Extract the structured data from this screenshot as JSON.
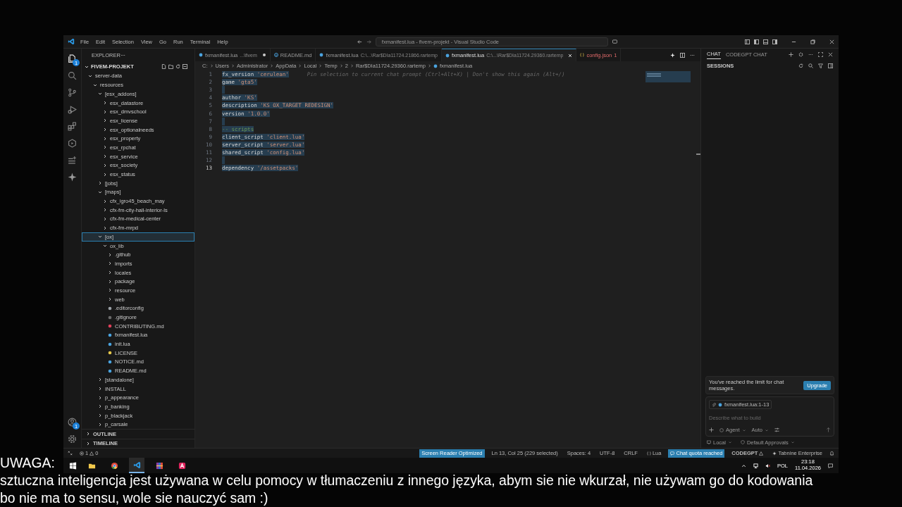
{
  "window": {
    "title": "fxmanifest.lua - fivem-projekt - Visual Studio Code",
    "menu": [
      "File",
      "Edit",
      "Selection",
      "View",
      "Go",
      "Run",
      "Terminal",
      "Help"
    ]
  },
  "activity_bar": {
    "explorer_badge": "1",
    "account_badge": "1"
  },
  "explorer": {
    "title": "EXPLORER",
    "project": "FIVEM-PROJEKT",
    "tree": [
      {
        "label": "server-data",
        "kind": "folder",
        "expanded": true,
        "selected": false,
        "children": [
          {
            "label": "resources",
            "kind": "folder",
            "expanded": true,
            "selected": false,
            "children": [
              {
                "label": "[esx_addons]",
                "kind": "folder",
                "expanded": true,
                "selected": false,
                "children": [
                  {
                    "label": "esx_datastore",
                    "kind": "folder",
                    "expanded": false,
                    "selected": false
                  },
                  {
                    "label": "esx_dmvschool",
                    "kind": "folder",
                    "expanded": false,
                    "selected": false
                  },
                  {
                    "label": "esx_license",
                    "kind": "folder",
                    "expanded": false,
                    "selected": false
                  },
                  {
                    "label": "esx_optionalneeds",
                    "kind": "folder",
                    "expanded": false,
                    "selected": false
                  },
                  {
                    "label": "esx_property",
                    "kind": "folder",
                    "expanded": false,
                    "selected": false
                  },
                  {
                    "label": "esx_rpchat",
                    "kind": "folder",
                    "expanded": false,
                    "selected": false
                  },
                  {
                    "label": "esx_service",
                    "kind": "folder",
                    "expanded": false,
                    "selected": false
                  },
                  {
                    "label": "esx_society",
                    "kind": "folder",
                    "expanded": false,
                    "selected": false
                  },
                  {
                    "label": "esx_status",
                    "kind": "folder",
                    "expanded": false,
                    "selected": false
                  }
                ]
              },
              {
                "label": "[jobs]",
                "kind": "folder",
                "expanded": false,
                "selected": false
              },
              {
                "label": "[maps]",
                "kind": "folder",
                "expanded": true,
                "selected": false,
                "children": [
                  {
                    "label": "cfx_igro45_beach_may",
                    "kind": "folder",
                    "expanded": false,
                    "selected": false
                  },
                  {
                    "label": "cfx-fm-city-hall-interior-ls",
                    "kind": "folder",
                    "expanded": false,
                    "selected": false
                  },
                  {
                    "label": "cfx-fm-medical-center",
                    "kind": "folder",
                    "expanded": false,
                    "selected": false
                  },
                  {
                    "label": "cfx-fm-mrpd",
                    "kind": "folder",
                    "expanded": false,
                    "selected": false
                  }
                ]
              },
              {
                "label": "[ox]",
                "kind": "folder",
                "expanded": true,
                "selected": true,
                "children": [
                  {
                    "label": "ox_lib",
                    "kind": "folder",
                    "expanded": true,
                    "selected": false,
                    "children": [
                      {
                        "label": ".github",
                        "kind": "folder",
                        "expanded": false,
                        "selected": false
                      },
                      {
                        "label": "imports",
                        "kind": "folder",
                        "expanded": false,
                        "selected": false
                      },
                      {
                        "label": "locales",
                        "kind": "folder",
                        "expanded": false,
                        "selected": false
                      },
                      {
                        "label": "package",
                        "kind": "folder",
                        "expanded": false,
                        "selected": false
                      },
                      {
                        "label": "resource",
                        "kind": "folder",
                        "expanded": false,
                        "selected": false
                      },
                      {
                        "label": "web",
                        "kind": "folder",
                        "expanded": false,
                        "selected": false
                      },
                      {
                        "label": ".editorconfig",
                        "kind": "gear",
                        "selected": false
                      },
                      {
                        "label": ".gitignore",
                        "kind": "ignore",
                        "selected": false
                      },
                      {
                        "label": "CONTRIBUTING.md",
                        "kind": "contributing",
                        "selected": false
                      },
                      {
                        "label": "fxmanifest.lua",
                        "kind": "lua",
                        "selected": false
                      },
                      {
                        "label": "init.lua",
                        "kind": "lua",
                        "selected": false
                      },
                      {
                        "label": "LICENSE",
                        "kind": "license",
                        "selected": false
                      },
                      {
                        "label": "NOTICE.md",
                        "kind": "notice",
                        "selected": false
                      },
                      {
                        "label": "README.md",
                        "kind": "info",
                        "selected": false
                      }
                    ]
                  }
                ]
              },
              {
                "label": "[standalone]",
                "kind": "folder",
                "expanded": false,
                "selected": false
              },
              {
                "label": "INSTALL",
                "kind": "folder",
                "expanded": false,
                "selected": false
              },
              {
                "label": "p_appearance",
                "kind": "folder",
                "expanded": false,
                "selected": false
              },
              {
                "label": "p_banking",
                "kind": "folder",
                "expanded": false,
                "selected": false
              },
              {
                "label": "p_blackjack",
                "kind": "folder",
                "expanded": false,
                "selected": false
              },
              {
                "label": "p_carsale",
                "kind": "folder",
                "expanded": false,
                "selected": false
              }
            ]
          }
        ]
      }
    ],
    "sections": [
      {
        "label": "OUTLINE",
        "expanded": false
      },
      {
        "label": "TIMELINE",
        "expanded": false
      }
    ]
  },
  "tabs": [
    {
      "label": "fxmanifest.lua",
      "description": "...\\fivem",
      "kind": "lua",
      "modified": true,
      "selected": false
    },
    {
      "label": "README.md",
      "kind": "info",
      "modified": false,
      "selected": false
    },
    {
      "label": "fxmanifest.lua",
      "description": "C:\\...\\Rar$DIa11724.21866.rartemp",
      "kind": "lua",
      "modified": false,
      "selected": false
    },
    {
      "label": "fxmanifest.lua",
      "description": "C:\\...\\Rar$DIa11724.29360.rartemp",
      "kind": "lua",
      "modified": false,
      "selected": true
    },
    {
      "label": "config.json",
      "badge": "1",
      "kind": "json",
      "modified": false,
      "selected": false
    }
  ],
  "breadcrumbs": [
    "C:",
    "Users",
    "Administrator",
    "AppData",
    "Local",
    "Temp",
    "2",
    "Rar$DIa11724.29360.rartemp",
    "fxmanifest.lua"
  ],
  "code": [
    {
      "number": "1",
      "text": "fx_version 'cerulean'",
      "selected": true,
      "hint": "Pin selection to current chat prompt (Ctrl+Alt+X) | Don't show this again (Alt+/)"
    },
    {
      "number": "2",
      "text": "game 'gta5'",
      "selected": true
    },
    {
      "number": "3",
      "selected": true
    },
    {
      "number": "4",
      "text": "author 'KS'",
      "selected": true
    },
    {
      "number": "5",
      "text": "description 'KS OX_TARGET REDESIGN'",
      "selected": true
    },
    {
      "number": "6",
      "text": "version '1.0.0'",
      "selected": true
    },
    {
      "number": "7",
      "selected": true
    },
    {
      "number": "8",
      "text": "-- scripts",
      "kind": "comment",
      "selected": true
    },
    {
      "number": "9",
      "text": "client_script 'client.lua'",
      "selected": true
    },
    {
      "number": "10",
      "text": "server_script 'server.lua'",
      "selected": true
    },
    {
      "number": "11",
      "text": "shared_script 'config.lua'",
      "selected": true
    },
    {
      "number": "12",
      "selected": true
    },
    {
      "number": "13",
      "text": "dependency '/assetpacks'",
      "selected": true,
      "current": true
    }
  ],
  "chat": {
    "tabs": [
      {
        "label": "CHAT",
        "selected": true
      },
      {
        "label": "CODEGPT CHAT",
        "selected": false
      }
    ],
    "sessions_title": "SESSIONS",
    "notice": "You've reached the limit for chat messages.",
    "upgrade_button": "Upgrade",
    "context_chip": "fxmanifest.lua:1-13",
    "placeholder": "Describe what to build",
    "mode": "Agent",
    "model": "Auto",
    "location": "Local",
    "approvals": "Default Approvals"
  },
  "status_bar": {
    "errors": "1",
    "warnings": "0",
    "items": [
      {
        "label": "Screen Reader Optimized",
        "highlighted": true
      },
      {
        "label": "Ln 13, Col 25 (229 selected)",
        "highlighted": false
      },
      {
        "label": "Spaces: 4",
        "highlighted": false
      },
      {
        "label": "UTF-8",
        "highlighted": false
      },
      {
        "label": "CRLF",
        "highlighted": false
      },
      {
        "label": "Lua",
        "kind": "language",
        "highlighted": false
      },
      {
        "label": "Chat quota reached",
        "kind": "chat",
        "highlighted": true
      },
      {
        "label": "CODEGPT",
        "kind": "warning",
        "highlighted": false
      },
      {
        "label": "Tabnine Enterprise",
        "kind": "tabnine",
        "highlighted": false
      }
    ]
  },
  "taskbar": {
    "apps": [
      {
        "kind": "files",
        "active": false
      },
      {
        "kind": "chrome",
        "active": false
      },
      {
        "kind": "vscode",
        "active": true
      },
      {
        "kind": "winrar",
        "active": false
      },
      {
        "kind": "red",
        "active": false
      }
    ],
    "language": "POL",
    "time": "23:18",
    "date": "11.04.2026"
  },
  "captions": [
    "UWAGA:",
    "sztuczna inteligencja jest używana w celu pomocy w tłumaczeniu z innego języka, abym sie nie wkurzał, nie używam go do kodowania",
    "bo nie ma to sensu, wole sie nauczyć sam :)"
  ]
}
